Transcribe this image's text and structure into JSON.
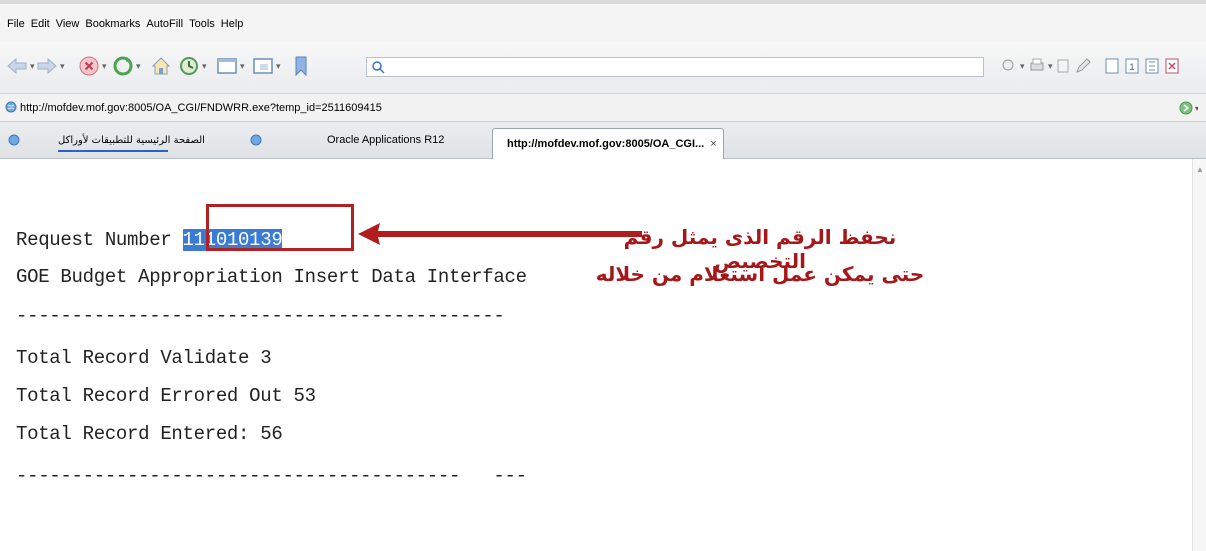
{
  "menu": [
    "File",
    "Edit",
    "View",
    "Bookmarks",
    "AutoFill",
    "Tools",
    "Help"
  ],
  "toolbar": {
    "buttons": [
      "back-icon",
      "forward-icon",
      "stop-icon",
      "refresh-icon",
      "home-icon",
      "history-icon",
      "page-icon",
      "window-icon",
      "bookmark-icon"
    ],
    "search_value": ""
  },
  "address": {
    "url": "http://mofdev.mof.gov:8005/OA_CGI/FNDWRR.exe?temp_id=2511609415"
  },
  "tabs": [
    {
      "label": "الصفحة الرئيسية للتطبيقات لأوراكل",
      "active": false
    },
    {
      "label": "Oracle Applications R12",
      "active": false
    },
    {
      "label": "http://mofdev.mof.gov:8005/OA_CGI...",
      "active": true,
      "close": "×"
    }
  ],
  "content": {
    "request_label": "Request Number ",
    "request_number": "111010139",
    "title": "GOE Budget Appropriation Insert Data Interface",
    "separator1": "--------------------------------------------",
    "line1": "Total Record Validate 3",
    "line2": "Total Record Errored Out 53",
    "line3": "Total Record Entered: 56",
    "separator2": "----------------------------------------   ---"
  },
  "annotation": {
    "line1": "نحفظ الرقم الذى يمثل رقم التخصيص",
    "line2": "حتى يمكن عمل استعلام من خلاله",
    "color": "#a6171a"
  },
  "colors": {
    "highlight": "#3a7bd5",
    "box": "#b22222"
  }
}
